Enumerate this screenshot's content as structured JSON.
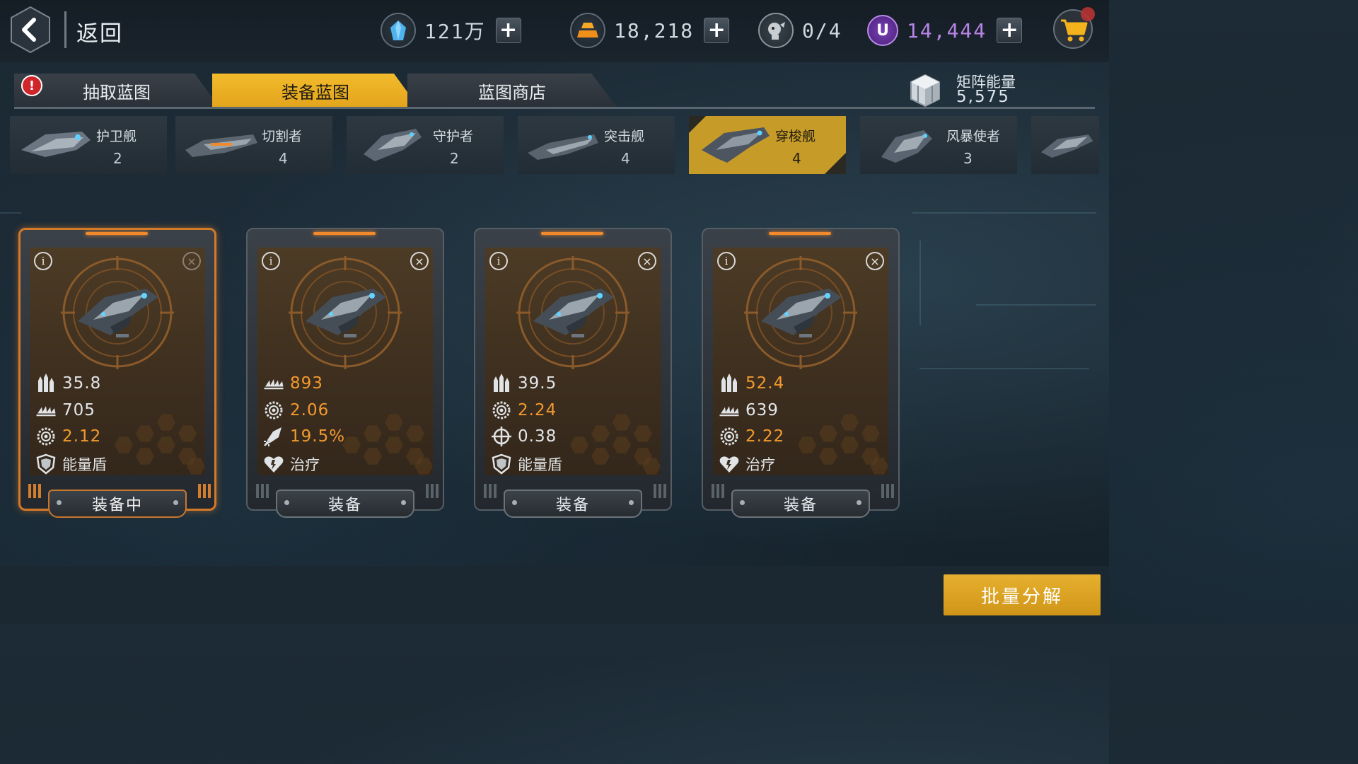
{
  "topbar": {
    "back_label": "返回",
    "resources": [
      {
        "id": "crystal",
        "icon": "crystal-icon",
        "value": "121万",
        "has_plus": true
      },
      {
        "id": "gold",
        "icon": "gold-bars-icon",
        "value": "18,218",
        "has_plus": true
      },
      {
        "id": "pilots",
        "icon": "pilot-icon",
        "value": "0/4",
        "has_plus": false
      },
      {
        "id": "u_currency",
        "icon": "u-currency-icon",
        "value": "14,444",
        "has_plus": true
      }
    ],
    "plus_symbol": "+",
    "cart_icon": "cart-icon"
  },
  "tabs": [
    {
      "label": "抽取蓝图",
      "active": false,
      "alert": "!"
    },
    {
      "label": "装备蓝图",
      "active": true
    },
    {
      "label": "蓝图商店",
      "active": false
    }
  ],
  "matrix": {
    "label": "矩阵能量",
    "value": "5,575",
    "icon": "cube-icon"
  },
  "ship_categories": [
    {
      "name": "护卫舰",
      "count": "2",
      "active": false
    },
    {
      "name": "切割者",
      "count": "4",
      "active": false
    },
    {
      "name": "守护者",
      "count": "2",
      "active": false
    },
    {
      "name": "突击舰",
      "count": "4",
      "active": false
    },
    {
      "name": "穿梭舰",
      "count": "4",
      "active": true
    },
    {
      "name": "风暴使者",
      "count": "3",
      "active": false
    }
  ],
  "cards": [
    {
      "equipped": true,
      "button": "装备中",
      "stats": [
        {
          "icon": "ammo-icon",
          "value": "35.8",
          "color": "white"
        },
        {
          "icon": "wings-icon",
          "value": "705",
          "color": "white"
        },
        {
          "icon": "gear-icon",
          "value": "2.12",
          "color": "orange"
        }
      ],
      "ability": {
        "icon": "shield-icon",
        "label": "能量盾"
      }
    },
    {
      "equipped": false,
      "button": "装备",
      "stats": [
        {
          "icon": "wings-icon",
          "value": "893",
          "color": "orange"
        },
        {
          "icon": "gear-icon",
          "value": "2.06",
          "color": "orange"
        },
        {
          "icon": "rocket-icon",
          "value": "19.5%",
          "color": "orange"
        }
      ],
      "ability": {
        "icon": "heal-heart-icon",
        "label": "治疗"
      }
    },
    {
      "equipped": false,
      "button": "装备",
      "stats": [
        {
          "icon": "ammo-icon",
          "value": "39.5",
          "color": "white"
        },
        {
          "icon": "gear-icon",
          "value": "2.24",
          "color": "orange"
        },
        {
          "icon": "crosshair-icon",
          "value": "0.38",
          "color": "white"
        }
      ],
      "ability": {
        "icon": "shield-icon",
        "label": "能量盾"
      }
    },
    {
      "equipped": false,
      "button": "装备",
      "stats": [
        {
          "icon": "ammo-icon",
          "value": "52.4",
          "color": "orange"
        },
        {
          "icon": "wings-icon",
          "value": "639",
          "color": "white"
        },
        {
          "icon": "gear-icon",
          "value": "2.22",
          "color": "orange"
        }
      ],
      "ability": {
        "icon": "heal-heart-icon",
        "label": "治疗"
      }
    }
  ],
  "card_icons": {
    "info": "i",
    "close": "×"
  },
  "batch_button": "批量分解",
  "colors": {
    "accent": "#e8ad24",
    "stat_orange": "#f39a2e",
    "equipped_border": "#d27a2a"
  }
}
